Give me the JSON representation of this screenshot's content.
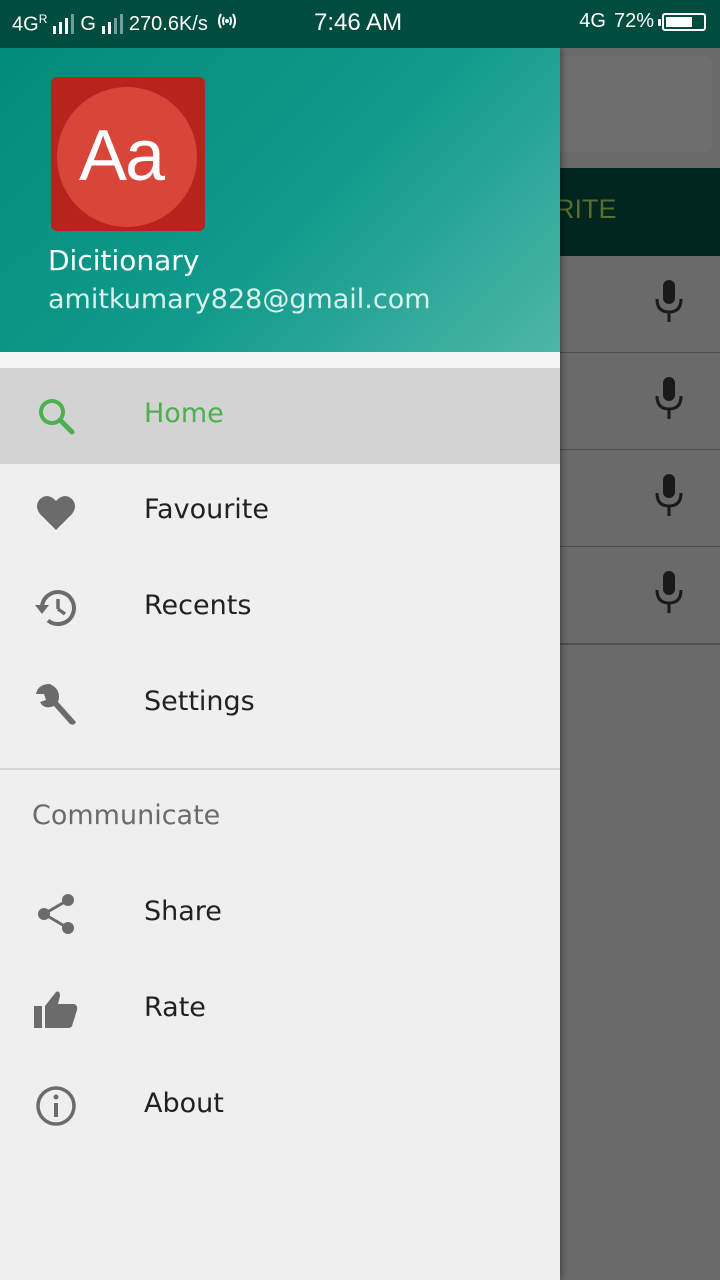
{
  "status_bar": {
    "net1": "4G",
    "net1_sup": "R",
    "net2": "G",
    "speed": "270.6K/s",
    "time": "7:46 AM",
    "net3": "4G",
    "battery": "72%",
    "battery_level": 0.72
  },
  "background": {
    "tab_partial": "RITE",
    "rows": 4
  },
  "drawer": {
    "header": {
      "logo_text": "Aa",
      "app_name": "Dicitionary",
      "email": "amitkumary828@gmail.com"
    },
    "items": [
      {
        "label": "Home",
        "icon": "search-icon",
        "active": true
      },
      {
        "label": "Favourite",
        "icon": "heart-icon"
      },
      {
        "label": "Recents",
        "icon": "history-icon"
      },
      {
        "label": "Settings",
        "icon": "wrench-icon"
      }
    ],
    "section_title": "Communicate",
    "items2": [
      {
        "label": "Share",
        "icon": "share-icon"
      },
      {
        "label": "Rate",
        "icon": "thumb-up-icon"
      },
      {
        "label": "About",
        "icon": "info-icon"
      }
    ]
  },
  "colors": {
    "status_bar": "#004d40",
    "header_start": "#008b7a",
    "header_end": "#4db6a8",
    "active_text": "#4caf50",
    "logo_bg": "#b5251d"
  }
}
